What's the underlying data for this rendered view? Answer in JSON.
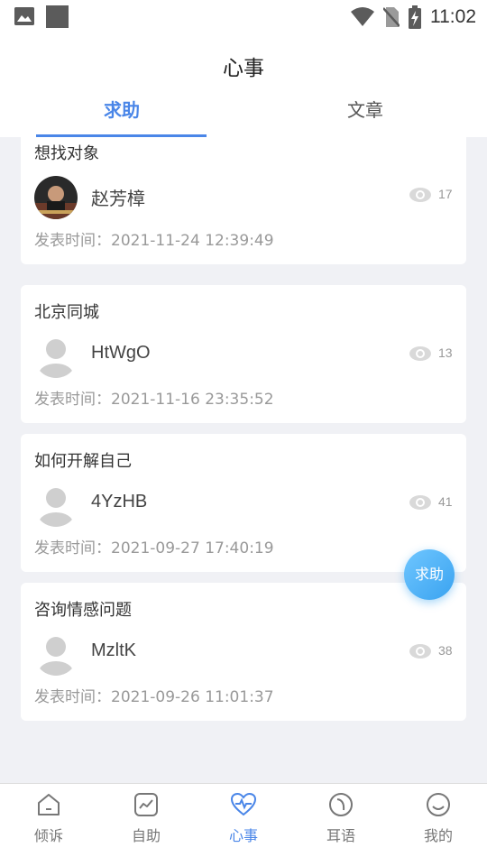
{
  "status_bar": {
    "time": "11:02",
    "icons": [
      "image-icon",
      "square-icon",
      "wifi-icon",
      "no-sim-icon",
      "battery-charging-icon"
    ]
  },
  "header": {
    "title": "心事",
    "tabs": [
      {
        "label": "求助",
        "active": true
      },
      {
        "label": "文章",
        "active": false
      }
    ]
  },
  "posts": [
    {
      "title": "想找对象",
      "user": "赵芳樟",
      "avatar": "photo",
      "views": "17",
      "time": "发表时间：2021-11-24 12:39:49"
    },
    {
      "title": "北京同城",
      "user": "HtWgO",
      "avatar": "default",
      "views": "13",
      "time": "发表时间：2021-11-16 23:35:52"
    },
    {
      "title": "如何开解自己",
      "user": "4YzHB",
      "avatar": "default",
      "views": "41",
      "time": "发表时间：2021-09-27 17:40:19"
    },
    {
      "title": "咨询情感问题",
      "user": "MzltK",
      "avatar": "default",
      "views": "38",
      "time": "发表时间：2021-09-26 11:01:37"
    }
  ],
  "float_button": {
    "label": "求助"
  },
  "bottom_nav": [
    {
      "label": "倾诉",
      "icon": "home-icon",
      "active": false
    },
    {
      "label": "自助",
      "icon": "chart-icon",
      "active": false
    },
    {
      "label": "心事",
      "icon": "heartbeat-icon",
      "active": true
    },
    {
      "label": "耳语",
      "icon": "whisper-icon",
      "active": false
    },
    {
      "label": "我的",
      "icon": "smile-icon",
      "active": false
    }
  ],
  "colors": {
    "accent": "#4a86e8",
    "float_button": "#3aa3f0",
    "background": "#f0f1f5"
  }
}
